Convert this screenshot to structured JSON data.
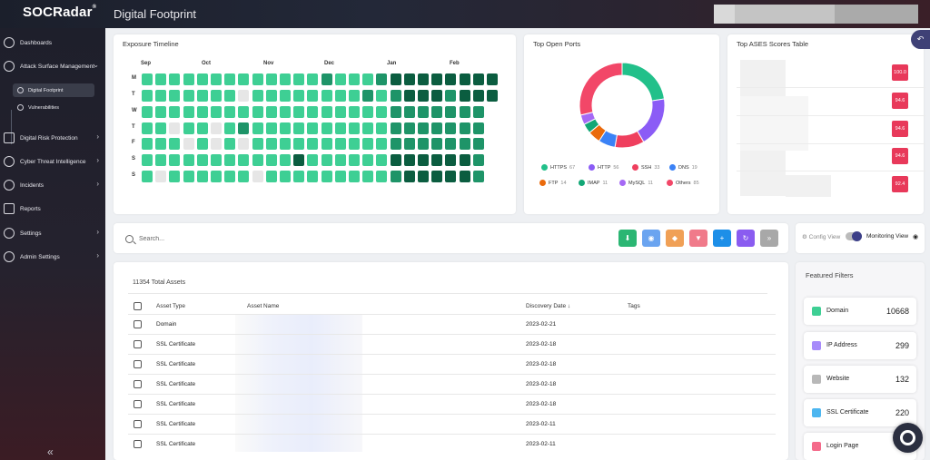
{
  "app": {
    "logo": "SOCRadar",
    "page_title": "Digital Footprint"
  },
  "sidebar": {
    "items": [
      {
        "label": "Dashboards",
        "name": "dashboards"
      },
      {
        "label": "Attack Surface Management",
        "name": "attack-surface-management"
      },
      {
        "label": "Digital Risk Protection",
        "name": "digital-risk-protection"
      },
      {
        "label": "Cyber Threat Intelligence",
        "name": "cyber-threat-intelligence"
      },
      {
        "label": "Incidents",
        "name": "incidents"
      },
      {
        "label": "Reports",
        "name": "reports"
      },
      {
        "label": "Settings",
        "name": "settings"
      },
      {
        "label": "Admin Settings",
        "name": "admin-settings"
      }
    ],
    "subitems": [
      {
        "label": "Digital Footprint",
        "active": true
      },
      {
        "label": "Vulnerabilities",
        "active": false
      }
    ]
  },
  "exposure": {
    "title": "Exposure Timeline",
    "months": [
      "Sep",
      "Oct",
      "Nov",
      "Dec",
      "Jan",
      "Feb"
    ],
    "days": [
      "M",
      "T",
      "W",
      "T",
      "F",
      "S",
      "S"
    ],
    "levels": [
      "11111111111112111233333333",
      "11111110111111112123332333",
      "1111111111111111112222222",
      "1101101211111111112222222",
      "1110101011111111112222222",
      "1111111111131111113333332",
      "1011111101111111112333332"
    ],
    "colors": {
      "0": "#e6e6e6",
      "1": "#3ecf94",
      "2": "#1e9468",
      "3": "#0b5d40"
    }
  },
  "ports": {
    "title": "Top Open Ports",
    "legend": [
      {
        "label": "HTTPS",
        "value": "67",
        "color": "#22c08a"
      },
      {
        "label": "HTTP",
        "value": "56",
        "color": "#8b5cf6"
      },
      {
        "label": "SSH",
        "value": "33",
        "color": "#ef3f5e"
      },
      {
        "label": "DNS",
        "value": "19",
        "color": "#3b82f6"
      },
      {
        "label": "FTP",
        "value": "14",
        "color": "#ea6a0c"
      },
      {
        "label": "IMAP",
        "value": "11",
        "color": "#12a776"
      },
      {
        "label": "MySQL",
        "value": "11",
        "color": "#a569f5"
      },
      {
        "label": "Others",
        "value": "85",
        "color": "#f24768"
      }
    ]
  },
  "scores": {
    "title": "Top ASES Scores Table",
    "values": [
      "100.0",
      "94.6",
      "94.6",
      "94.6",
      "92.4"
    ]
  },
  "toolbar": {
    "search_placeholder": "Search...",
    "buttons": [
      {
        "name": "download-button",
        "icon": "⬇",
        "color": "#2bb673"
      },
      {
        "name": "view-button",
        "icon": "◉",
        "color": "#6aa4f0"
      },
      {
        "name": "tag-button",
        "icon": "◆",
        "color": "#f0a056"
      },
      {
        "name": "dislike-button",
        "icon": "▼",
        "color": "#f07a8a"
      },
      {
        "name": "add-button",
        "icon": "+",
        "color": "#1d8fe8"
      },
      {
        "name": "refresh-button",
        "icon": "↻",
        "color": "#8a5cf0"
      },
      {
        "name": "more-button",
        "icon": "»",
        "color": "#a8a8a8"
      }
    ]
  },
  "view_toggle": {
    "config": "Config View",
    "monitoring": "Monitoring View"
  },
  "assets": {
    "total": "11354 Total Assets",
    "headers": {
      "type": "Asset Type",
      "name": "Asset Name",
      "date": "Discovery Date",
      "tags": "Tags"
    },
    "sort_icon": "↓",
    "rows": [
      {
        "type": "Domain",
        "date": "2023-02-21"
      },
      {
        "type": "SSL Certificate",
        "date": "2023-02-18"
      },
      {
        "type": "SSL Certificate",
        "date": "2023-02-18"
      },
      {
        "type": "SSL Certificate",
        "date": "2023-02-18"
      },
      {
        "type": "SSL Certificate",
        "date": "2023-02-18"
      },
      {
        "type": "SSL Certificate",
        "date": "2023-02-11"
      },
      {
        "type": "SSL Certificate",
        "date": "2023-02-11"
      }
    ]
  },
  "featured": {
    "title": "Featured Filters",
    "items": [
      {
        "label": "Domain",
        "count": "10668",
        "color": "#3ecf94"
      },
      {
        "label": "IP Address",
        "count": "299",
        "color": "#a78bfa"
      },
      {
        "label": "Website",
        "count": "132",
        "color": "#b8b8b8"
      },
      {
        "label": "SSL Certificate",
        "count": "220",
        "color": "#4db6f0"
      },
      {
        "label": "Login Page",
        "count": "",
        "color": "#f46a8a"
      }
    ]
  }
}
